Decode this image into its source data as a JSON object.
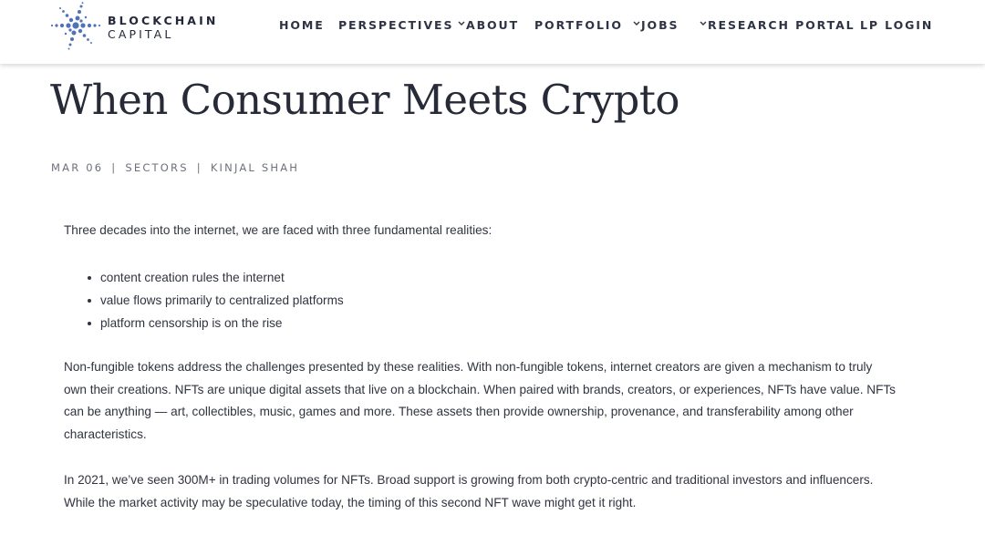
{
  "brand": {
    "name_line1": "BLOCKCHAIN",
    "name_line2": "CAPITAL",
    "logo_icon": "star-burst-logo-icon",
    "color_dark": "#23283a",
    "color_blue": "#4f72b8"
  },
  "nav": {
    "home": "HOME",
    "perspectives": "PERSPECTIVES",
    "about": "ABOUT",
    "portfolio": "PORTFOLIO",
    "jobs": "JOBS",
    "research_portal": "RESEARCH PORTAL",
    "lp_login": "LP LOGIN",
    "dropdown_icon": "chevron-down-icon"
  },
  "article": {
    "title": "When Consumer Meets Crypto",
    "meta": {
      "date": "MAR 06",
      "category": "SECTORS",
      "author": "KINJAL SHAH",
      "separator": "|"
    },
    "intro": "Three decades into the internet, we are faced with three fundamental realities:",
    "bullets": [
      "content creation rules the internet",
      "value flows primarily to centralized platforms",
      "platform censorship is on the rise"
    ],
    "paragraph2_lines": [
      "Non-fungible tokens address the challenges presented by these realities. With non-fungible tokens, internet creators are given a mechanism to truly",
      "own their creations. NFTs are unique digital assets that live on a blockchain. When paired with brands, creators, or experiences, NFTs have value. NFTs",
      "can be anything — art, collectibles, music, games and more. These assets then provide ownership, provenance, and transferability among other",
      "characteristics."
    ],
    "paragraph3_lines": [
      "In 2021, we’ve seen 300M+ in trading volumes for NFTs. Broad support is growing from both crypto-centric and traditional investors and influencers.",
      "While the market activity may be speculative today, the timing of this second NFT wave might get it right."
    ]
  }
}
